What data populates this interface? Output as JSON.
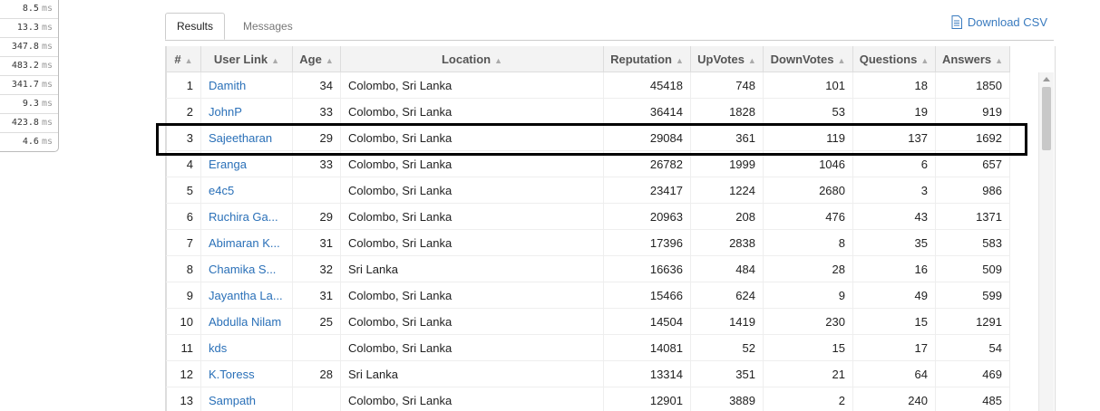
{
  "timings": [
    {
      "value": "8.5",
      "unit": "ms"
    },
    {
      "value": "13.3",
      "unit": "ms"
    },
    {
      "value": "347.8",
      "unit": "ms"
    },
    {
      "value": "483.2",
      "unit": "ms"
    },
    {
      "value": "341.7",
      "unit": "ms"
    },
    {
      "value": "9.3",
      "unit": "ms"
    },
    {
      "value": "423.8",
      "unit": "ms"
    },
    {
      "value": "4.6",
      "unit": "ms"
    }
  ],
  "tabs": {
    "results": "Results",
    "messages": "Messages"
  },
  "download_label": "Download CSV",
  "columns": [
    "#",
    "User Link",
    "Age",
    "Location",
    "Reputation",
    "UpVotes",
    "DownVotes",
    "Questions",
    "Answers"
  ],
  "rows": [
    {
      "n": "1",
      "user": "Damith",
      "age": "34",
      "location": "Colombo, Sri Lanka",
      "rep": "45418",
      "up": "748",
      "down": "101",
      "q": "18",
      "a": "1850"
    },
    {
      "n": "2",
      "user": "JohnP",
      "age": "33",
      "location": "Colombo, Sri Lanka",
      "rep": "36414",
      "up": "1828",
      "down": "53",
      "q": "19",
      "a": "919"
    },
    {
      "n": "3",
      "user": "Sajeetharan",
      "age": "29",
      "location": "Colombo, Sri Lanka",
      "rep": "29084",
      "up": "361",
      "down": "119",
      "q": "137",
      "a": "1692"
    },
    {
      "n": "4",
      "user": "Eranga",
      "age": "33",
      "location": "Colombo, Sri Lanka",
      "rep": "26782",
      "up": "1999",
      "down": "1046",
      "q": "6",
      "a": "657"
    },
    {
      "n": "5",
      "user": "e4c5",
      "age": "",
      "location": "Colombo, Sri Lanka",
      "rep": "23417",
      "up": "1224",
      "down": "2680",
      "q": "3",
      "a": "986"
    },
    {
      "n": "6",
      "user": "Ruchira Ga...",
      "age": "29",
      "location": "Colombo, Sri Lanka",
      "rep": "20963",
      "up": "208",
      "down": "476",
      "q": "43",
      "a": "1371"
    },
    {
      "n": "7",
      "user": "Abimaran K...",
      "age": "31",
      "location": "Colombo, Sri Lanka",
      "rep": "17396",
      "up": "2838",
      "down": "8",
      "q": "35",
      "a": "583"
    },
    {
      "n": "8",
      "user": "Chamika S...",
      "age": "32",
      "location": "Sri Lanka",
      "rep": "16636",
      "up": "484",
      "down": "28",
      "q": "16",
      "a": "509"
    },
    {
      "n": "9",
      "user": "Jayantha La...",
      "age": "31",
      "location": "Colombo, Sri Lanka",
      "rep": "15466",
      "up": "624",
      "down": "9",
      "q": "49",
      "a": "599"
    },
    {
      "n": "10",
      "user": "Abdulla Nilam",
      "age": "25",
      "location": "Colombo, Sri Lanka",
      "rep": "14504",
      "up": "1419",
      "down": "230",
      "q": "15",
      "a": "1291"
    },
    {
      "n": "11",
      "user": "kds",
      "age": "",
      "location": "Colombo, Sri Lanka",
      "rep": "14081",
      "up": "52",
      "down": "15",
      "q": "17",
      "a": "54"
    },
    {
      "n": "12",
      "user": "K.Toress",
      "age": "28",
      "location": "Sri Lanka",
      "rep": "13314",
      "up": "351",
      "down": "21",
      "q": "64",
      "a": "469"
    },
    {
      "n": "13",
      "user": "Sampath",
      "age": "",
      "location": "Colombo, Sri Lanka",
      "rep": "12901",
      "up": "3889",
      "down": "2",
      "q": "240",
      "a": "485"
    }
  ]
}
